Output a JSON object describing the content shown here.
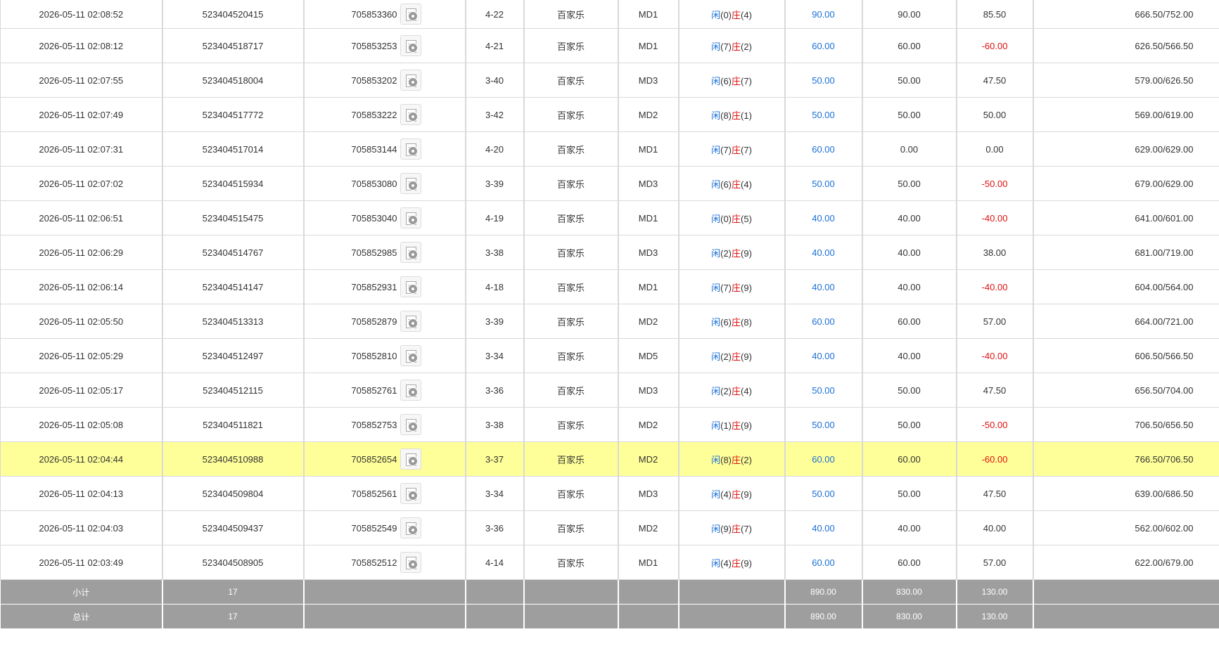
{
  "rows": [
    {
      "time": "2026-05-11 02:08:52",
      "bet_id": "523404520415",
      "round_id": "705853360",
      "shoe": "4-22",
      "game": "百家乐",
      "table": "MD1",
      "player_label": "闲",
      "player": "(0)",
      "banker_label": "庄",
      "banker": "(4)",
      "bet": "90.00",
      "valid": "90.00",
      "win": "85.50",
      "win_color": "#333333",
      "balance": "666.50/752.00"
    },
    {
      "time": "2026-05-11 02:08:12",
      "bet_id": "523404518717",
      "round_id": "705853253",
      "shoe": "4-21",
      "game": "百家乐",
      "table": "MD1",
      "player_label": "闲",
      "player": "(7)",
      "banker_label": "庄",
      "banker": "(2)",
      "bet": "60.00",
      "valid": "60.00",
      "win": "-60.00",
      "win_color": "#e01010",
      "balance": "626.50/566.50"
    },
    {
      "time": "2026-05-11 02:07:55",
      "bet_id": "523404518004",
      "round_id": "705853202",
      "shoe": "3-40",
      "game": "百家乐",
      "table": "MD3",
      "player_label": "闲",
      "player": "(6)",
      "banker_label": "庄",
      "banker": "(7)",
      "bet": "50.00",
      "valid": "50.00",
      "win": "47.50",
      "win_color": "#333333",
      "balance": "579.00/626.50"
    },
    {
      "time": "2026-05-11 02:07:49",
      "bet_id": "523404517772",
      "round_id": "705853222",
      "shoe": "3-42",
      "game": "百家乐",
      "table": "MD2",
      "player_label": "闲",
      "player": "(8)",
      "banker_label": "庄",
      "banker": "(1)",
      "bet": "50.00",
      "valid": "50.00",
      "win": "50.00",
      "win_color": "#333333",
      "balance": "569.00/619.00"
    },
    {
      "time": "2026-05-11 02:07:31",
      "bet_id": "523404517014",
      "round_id": "705853144",
      "shoe": "4-20",
      "game": "百家乐",
      "table": "MD1",
      "player_label": "闲",
      "player": "(7)",
      "banker_label": "庄",
      "banker": "(7)",
      "bet": "60.00",
      "valid": "0.00",
      "win": "0.00",
      "win_color": "#333333",
      "balance": "629.00/629.00"
    },
    {
      "time": "2026-05-11 02:07:02",
      "bet_id": "523404515934",
      "round_id": "705853080",
      "shoe": "3-39",
      "game": "百家乐",
      "table": "MD3",
      "player_label": "闲",
      "player": "(6)",
      "banker_label": "庄",
      "banker": "(4)",
      "bet": "50.00",
      "valid": "50.00",
      "win": "-50.00",
      "win_color": "#e01010",
      "balance": "679.00/629.00"
    },
    {
      "time": "2026-05-11 02:06:51",
      "bet_id": "523404515475",
      "round_id": "705853040",
      "shoe": "4-19",
      "game": "百家乐",
      "table": "MD1",
      "player_label": "闲",
      "player": "(0)",
      "banker_label": "庄",
      "banker": "(5)",
      "bet": "40.00",
      "valid": "40.00",
      "win": "-40.00",
      "win_color": "#e01010",
      "balance": "641.00/601.00"
    },
    {
      "time": "2026-05-11 02:06:29",
      "bet_id": "523404514767",
      "round_id": "705852985",
      "shoe": "3-38",
      "game": "百家乐",
      "table": "MD3",
      "player_label": "闲",
      "player": "(2)",
      "banker_label": "庄",
      "banker": "(9)",
      "bet": "40.00",
      "valid": "40.00",
      "win": "38.00",
      "win_color": "#333333",
      "balance": "681.00/719.00"
    },
    {
      "time": "2026-05-11 02:06:14",
      "bet_id": "523404514147",
      "round_id": "705852931",
      "shoe": "4-18",
      "game": "百家乐",
      "table": "MD1",
      "player_label": "闲",
      "player": "(7)",
      "banker_label": "庄",
      "banker": "(9)",
      "bet": "40.00",
      "valid": "40.00",
      "win": "-40.00",
      "win_color": "#e01010",
      "balance": "604.00/564.00"
    },
    {
      "time": "2026-05-11 02:05:50",
      "bet_id": "523404513313",
      "round_id": "705852879",
      "shoe": "3-39",
      "game": "百家乐",
      "table": "MD2",
      "player_label": "闲",
      "player": "(6)",
      "banker_label": "庄",
      "banker": "(8)",
      "bet": "60.00",
      "valid": "60.00",
      "win": "57.00",
      "win_color": "#333333",
      "balance": "664.00/721.00"
    },
    {
      "time": "2026-05-11 02:05:29",
      "bet_id": "523404512497",
      "round_id": "705852810",
      "shoe": "3-34",
      "game": "百家乐",
      "table": "MD5",
      "player_label": "闲",
      "player": "(2)",
      "banker_label": "庄",
      "banker": "(9)",
      "bet": "40.00",
      "valid": "40.00",
      "win": "-40.00",
      "win_color": "#e01010",
      "balance": "606.50/566.50"
    },
    {
      "time": "2026-05-11 02:05:17",
      "bet_id": "523404512115",
      "round_id": "705852761",
      "shoe": "3-36",
      "game": "百家乐",
      "table": "MD3",
      "player_label": "闲",
      "player": "(2)",
      "banker_label": "庄",
      "banker": "(4)",
      "bet": "50.00",
      "valid": "50.00",
      "win": "47.50",
      "win_color": "#333333",
      "balance": "656.50/704.00"
    },
    {
      "time": "2026-05-11 02:05:08",
      "bet_id": "523404511821",
      "round_id": "705852753",
      "shoe": "3-38",
      "game": "百家乐",
      "table": "MD2",
      "player_label": "闲",
      "player": "(1)",
      "banker_label": "庄",
      "banker": "(9)",
      "bet": "50.00",
      "valid": "50.00",
      "win": "-50.00",
      "win_color": "#e01010",
      "balance": "706.50/656.50"
    },
    {
      "time": "2026-05-11 02:04:44",
      "bet_id": "523404510988",
      "round_id": "705852654",
      "shoe": "3-37",
      "game": "百家乐",
      "table": "MD2",
      "player_label": "闲",
      "player": "(8)",
      "banker_label": "庄",
      "banker": "(2)",
      "bet": "60.00",
      "valid": "60.00",
      "win": "-60.00",
      "win_color": "#e01010",
      "balance": "766.50/706.50",
      "highlight": true
    },
    {
      "time": "2026-05-11 02:04:13",
      "bet_id": "523404509804",
      "round_id": "705852561",
      "shoe": "3-34",
      "game": "百家乐",
      "table": "MD3",
      "player_label": "闲",
      "player": "(4)",
      "banker_label": "庄",
      "banker": "(9)",
      "bet": "50.00",
      "valid": "50.00",
      "win": "47.50",
      "win_color": "#333333",
      "balance": "639.00/686.50"
    },
    {
      "time": "2026-05-11 02:04:03",
      "bet_id": "523404509437",
      "round_id": "705852549",
      "shoe": "3-36",
      "game": "百家乐",
      "table": "MD2",
      "player_label": "闲",
      "player": "(9)",
      "banker_label": "庄",
      "banker": "(7)",
      "bet": "40.00",
      "valid": "40.00",
      "win": "40.00",
      "win_color": "#333333",
      "balance": "562.00/602.00"
    },
    {
      "time": "2026-05-11 02:03:49",
      "bet_id": "523404508905",
      "round_id": "705852512",
      "shoe": "4-14",
      "game": "百家乐",
      "table": "MD1",
      "player_label": "闲",
      "player": "(4)",
      "banker_label": "庄",
      "banker": "(9)",
      "bet": "60.00",
      "valid": "60.00",
      "win": "57.00",
      "win_color": "#333333",
      "balance": "622.00/679.00"
    }
  ],
  "subtotal": {
    "label": "小计",
    "count": "17",
    "bet": "890.00",
    "valid": "830.00",
    "win": "130.00"
  },
  "total": {
    "label": "总计",
    "count": "17",
    "bet": "890.00",
    "valid": "830.00",
    "win": "130.00"
  },
  "colors": {
    "highlight_row": "#ffff99",
    "bet_blue": "#1a6fd6",
    "loss_red": "#e01010",
    "total_bg": "#9e9e9e"
  },
  "icons": {
    "replay": "video-replay-icon"
  }
}
